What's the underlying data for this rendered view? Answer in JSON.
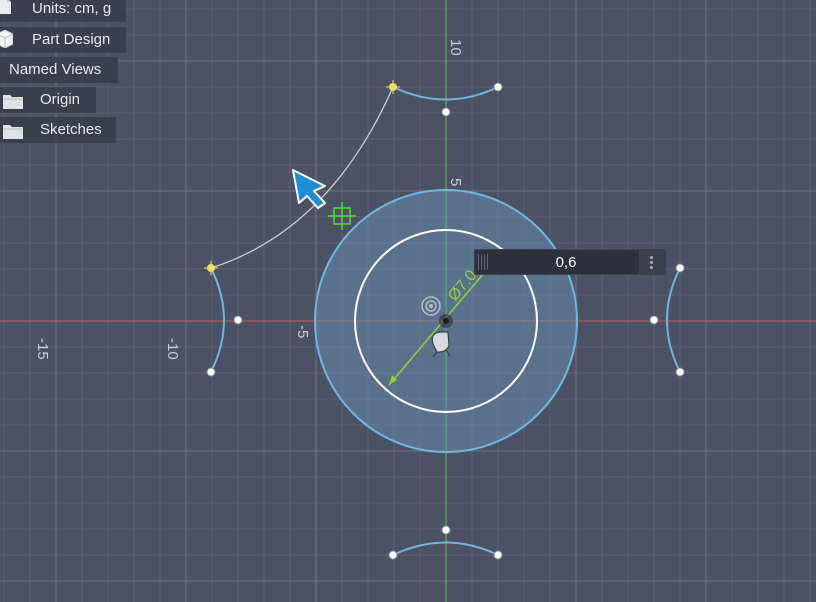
{
  "browser": {
    "units_label": "Units: cm, g",
    "design_label": "Part Design",
    "named_views_label": "Named Views",
    "origin_label": "Origin",
    "sketches_label": "Sketches"
  },
  "canvas": {
    "axis_labels": {
      "x_neg_15": "-15",
      "x_neg_10": "-10",
      "x_neg_5": "-5",
      "y_pos_10": "10",
      "y_pos_5": "5"
    },
    "diameter_dimension": "Ø7.0",
    "colors": {
      "background": "#4a5263",
      "grid_minor": "#59606f",
      "grid_major": "#6d7483",
      "x_axis": "#c45a5a",
      "y_axis": "#5fbf5f",
      "sketch_curve": "#6fb6de",
      "selected_point": "#f0e060",
      "dimension": "#8ed32e"
    },
    "icons": [
      "cursor-arrow-icon",
      "sketch-point-icon",
      "origin-icon",
      "move-gizmo-icon"
    ]
  },
  "value_input": {
    "value": "0,6"
  }
}
